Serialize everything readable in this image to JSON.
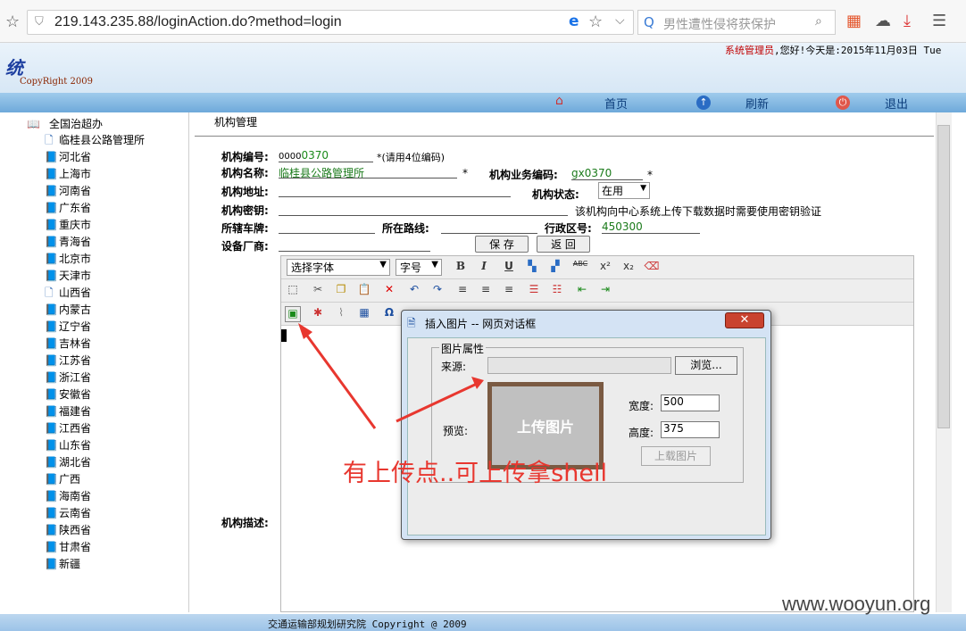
{
  "browser": {
    "url": "219.143.235.88/loginAction.do?method=login",
    "search_placeholder": "男性遭性侵将获保护"
  },
  "header": {
    "logo_glyph": "统",
    "copyright": "CopyRight 2009",
    "user": "系统管理员",
    "greeting": ",您好!今天是:2015年11月03日 Tue"
  },
  "nav": {
    "home": "首页",
    "refresh": "刷新",
    "logout": "退出"
  },
  "tree": {
    "root": "全国治超办",
    "items": [
      {
        "label": "临桂县公路管理所",
        "type": "doc"
      },
      {
        "label": "河北省",
        "type": "book"
      },
      {
        "label": "上海市",
        "type": "book"
      },
      {
        "label": "河南省",
        "type": "book"
      },
      {
        "label": "广东省",
        "type": "book"
      },
      {
        "label": "重庆市",
        "type": "book"
      },
      {
        "label": "青海省",
        "type": "book"
      },
      {
        "label": "北京市",
        "type": "book"
      },
      {
        "label": "天津市",
        "type": "book"
      },
      {
        "label": "山西省",
        "type": "doc"
      },
      {
        "label": "内蒙古",
        "type": "book"
      },
      {
        "label": "辽宁省",
        "type": "book"
      },
      {
        "label": "吉林省",
        "type": "book"
      },
      {
        "label": "江苏省",
        "type": "book"
      },
      {
        "label": "浙江省",
        "type": "book"
      },
      {
        "label": "安徽省",
        "type": "book"
      },
      {
        "label": "福建省",
        "type": "book"
      },
      {
        "label": "江西省",
        "type": "book"
      },
      {
        "label": "山东省",
        "type": "book"
      },
      {
        "label": "湖北省",
        "type": "book"
      },
      {
        "label": "广西",
        "type": "book"
      },
      {
        "label": "海南省",
        "type": "book"
      },
      {
        "label": "云南省",
        "type": "book"
      },
      {
        "label": "陕西省",
        "type": "book"
      },
      {
        "label": "甘肃省",
        "type": "book"
      },
      {
        "label": "新疆",
        "type": "book"
      }
    ]
  },
  "form": {
    "title": "机构管理",
    "code_label": "机构编号:",
    "code_prefix": "0000",
    "code_value": "0370",
    "code_hint": "*(请用4位编码)",
    "name_label": "机构名称:",
    "name_value": "临桂县公路管理所",
    "biz_label": "机构业务编码:",
    "biz_value": "gx0370",
    "star": "*",
    "addr_label": "机构地址:",
    "status_label": "机构状态:",
    "status_value": "在用",
    "key_label": "机构密钥:",
    "key_hint": "该机构向中心系统上传下载数据时需要使用密钥验证",
    "plate_label": "所辖车牌:",
    "route_label": "所在路线:",
    "region_label": "行政区号:",
    "region_value": "450300",
    "vendor_label": "设备厂商:",
    "save": "保 存",
    "back": "返 回",
    "desc_label": "机构描述:"
  },
  "editor": {
    "font_select": "选择字体",
    "size_select": "字号"
  },
  "dialog": {
    "title": "插入图片 -- 网页对话框",
    "group": "图片属性",
    "source_label": "来源:",
    "browse": "浏览...",
    "preview_label": "预览:",
    "preview_text": "上传图片",
    "width_label": "宽度:",
    "width_value": "500",
    "height_label": "高度:",
    "height_value": "375",
    "upload": "上载图片"
  },
  "annotation": "有上传点..可上传拿shell",
  "footer": "交通运输部规划研究院 Copyright @ 2009",
  "watermark": "www.wooyun.org"
}
